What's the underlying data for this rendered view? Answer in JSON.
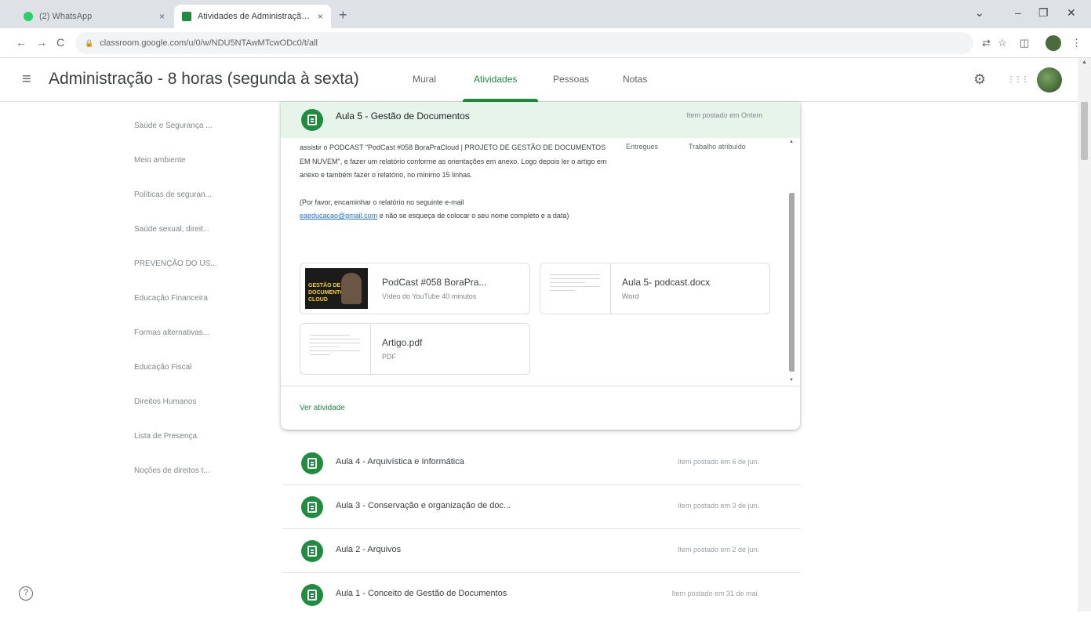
{
  "browser": {
    "tabs": [
      {
        "title": "(2) WhatsApp",
        "close": "×"
      },
      {
        "title": "Atividades de Administração - 8",
        "close": "×"
      }
    ],
    "new_tab": "+",
    "window_controls": {
      "chevron": "⌄",
      "minimize": "–",
      "restore": "❐",
      "close": "✕"
    },
    "nav": {
      "back": "←",
      "forward": "→",
      "reload": "C"
    },
    "url": "classroom.google.com/u/0/w/NDU5NTAwMTcwODc0/t/all",
    "lock": "🔒",
    "omni_icons": {
      "translate": "⇄",
      "star": "☆",
      "sidebar": "◫",
      "menu": "⋮"
    }
  },
  "classroom": {
    "menu_icon": "≡",
    "title": "Administração - 8 horas (segunda à sexta)",
    "tabs": [
      {
        "label": "Mural"
      },
      {
        "label": "Atividades"
      },
      {
        "label": "Pessoas"
      },
      {
        "label": "Notas"
      }
    ],
    "header_icons": {
      "settings": "⚙",
      "apps": "⋮⋮⋮"
    },
    "accent_color": "#1e8e3e"
  },
  "sidebar": {
    "topics": [
      "Saúde e Segurança ...",
      "Meio ambiente",
      "Políticas de seguran...",
      "Saúde sexual, direit...",
      "PREVENÇÃO DO US...",
      "Educação Financeira",
      "Formas alternativas...",
      "Educação Fiscal",
      "Direitos Humanos",
      "Lista de Presença",
      "Noções de direitos t..."
    ],
    "help": "?"
  },
  "expanded": {
    "title": "Aula 5 - Gestão de Documentos",
    "meta": "Item postado em Ontem",
    "description_1": "assistir o PODCAST \"PodCast #058 BoraPraCloud | PROJETO DE GESTÃO DE DOCUMENTOS EM NUVEM\", e fazer um relatório conforme as orientações em anexo. Logo depois ler o artigo em anexo e também fazer o relatório, no mínimo 15 linhas.",
    "description_2_prefix": "(Por favor, encaminhar o relatório no seguinte e-mail",
    "email": "eaeducacao@gmail.com",
    "description_2_suffix": "e não se esqueça de colocar o seu nome completo e a data)",
    "stats": {
      "turned_in": "Entregues",
      "assigned": "Trabalho atribuído"
    },
    "video_thumb_text": "GESTÃO DE DOCUMENTOS EM CLOUD",
    "attachments": [
      {
        "title": "PodCast #058 BoraPra...",
        "subtitle": "Vídeo do YouTube  40 minutos"
      },
      {
        "title": "Aula 5- podcast.docx",
        "subtitle": "Word"
      },
      {
        "title": "Artigo.pdf",
        "subtitle": "PDF"
      }
    ],
    "view_link": "Ver atividade"
  },
  "items": [
    {
      "title": "Aula 4 - Arquivística e Informática",
      "meta": "Item postado em 6 de jun."
    },
    {
      "title": "Aula 3 - Conservação e organização de doc...",
      "meta": "Item postado em 3 de jun."
    },
    {
      "title": "Aula 2 - Arquivos",
      "meta": "Item postado em 2 de jun."
    },
    {
      "title": "Aula 1 - Conceito de Gestão de Documentos",
      "meta": "Item postado em 31 de mai."
    }
  ]
}
